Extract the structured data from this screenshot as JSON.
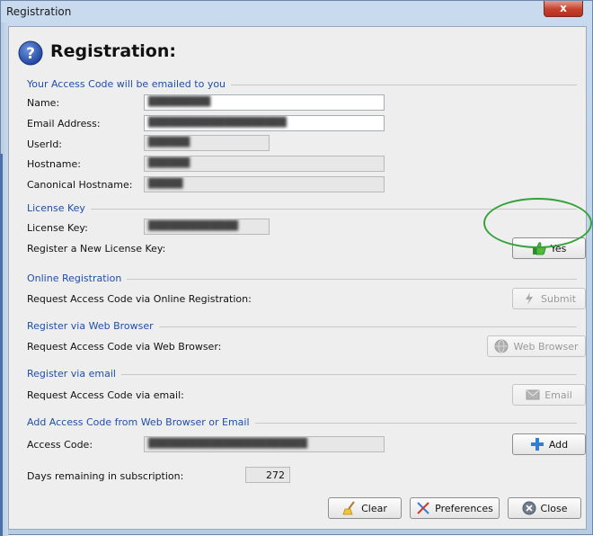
{
  "window": {
    "title": "Registration",
    "close_glyph": "x"
  },
  "header": {
    "title": "Registration:",
    "icon": "help-icon"
  },
  "sections": {
    "access": "Your Access Code will be emailed to you",
    "license": "License Key",
    "online": "Online Registration",
    "web": "Register via Web Browser",
    "email": "Register via email",
    "add": "Add Access Code from Web Browser or Email"
  },
  "fields": {
    "name_label": "Name:",
    "name_value": "█████████",
    "email_label": "Email Address:",
    "email_value": "████████████████████",
    "userid_label": "UserId:",
    "userid_value": "██████",
    "hostname_label": "Hostname:",
    "hostname_value": "██████",
    "canonical_label": "Canonical Hostname:",
    "canonical_value": "█████",
    "license_label": "License Key:",
    "license_value": "█████████████",
    "register_new_label": "Register a New License Key:",
    "online_label": "Request Access Code via Online Registration:",
    "web_label": "Request Access Code via Web Browser:",
    "email_req_label": "Request Access Code via email:",
    "access_code_label": "Access Code:",
    "access_code_value": "███████████████████████",
    "days_label": "Days remaining in subscription:",
    "days_value": "272"
  },
  "buttons": {
    "yes": "Yes",
    "submit": "Submit",
    "web_browser": "Web Browser",
    "email": "Email",
    "add": "Add",
    "clear": "Clear",
    "preferences": "Preferences",
    "close": "Close"
  },
  "colors": {
    "section_title": "#1f4fa8",
    "highlight_oval": "#33a23a",
    "title_bar": "#c9daee"
  }
}
